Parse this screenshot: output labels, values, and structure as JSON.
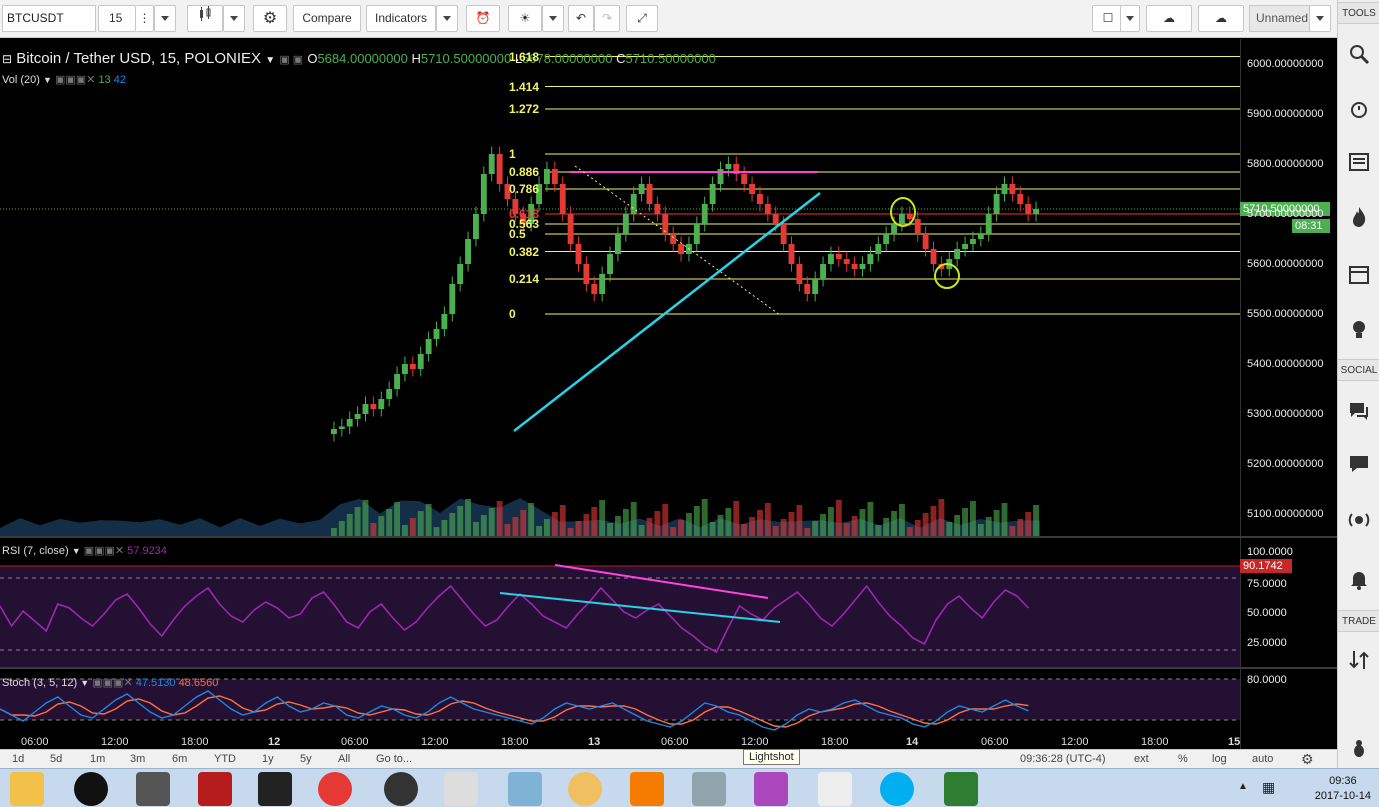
{
  "toolbar": {
    "symbol": "BTCUSDT",
    "interval": "15",
    "compare_label": "Compare",
    "indicators_label": "Indicators",
    "layout_name": "Unnamed"
  },
  "legend": {
    "title": "Bitcoin / Tether USD, 15, POLONIEX",
    "open_label": "O",
    "open": "5684.00000000",
    "high_label": "H",
    "high": "5710.50000000",
    "low_label": "L",
    "low": "5678.00000000",
    "close_label": "C",
    "close": "5710.50000000",
    "vol_label": "Vol (20)",
    "vol_a": "13",
    "vol_b": "42",
    "rsi_label": "RSI (7, close)",
    "rsi_value": "57.9234",
    "stoch_label": "Stoch (3, 5, 12)",
    "stoch_k": "47.5130",
    "stoch_d": "48.6560"
  },
  "price_axis": [
    "6000.00000000",
    "5900.00000000",
    "5800.00000000",
    "5700.00000000",
    "5600.00000000",
    "5500.00000000",
    "5400.00000000",
    "5300.00000000",
    "5200.00000000",
    "5100.00000000"
  ],
  "current_price": "5710.50000000",
  "countdown": "08:31",
  "rsi_axis": [
    "100.0000",
    "75.0000",
    "50.0000",
    "25.0000"
  ],
  "rsi_marker": "90.1742",
  "stoch_axis": [
    "80.0000"
  ],
  "time_axis": [
    "06:00",
    "12:00",
    "18:00",
    "12",
    "06:00",
    "12:00",
    "18:00",
    "13",
    "06:00",
    "12:00",
    "18:00",
    "14",
    "06:00",
    "12:00",
    "18:00",
    "15"
  ],
  "fib_levels": [
    {
      "label": "1.618",
      "price": 6015
    },
    {
      "label": "1.414",
      "price": 5955
    },
    {
      "label": "1.272",
      "price": 5910
    },
    {
      "label": "1",
      "price": 5820
    },
    {
      "label": "0.886",
      "price": 5784
    },
    {
      "label": "0.786",
      "price": 5750
    },
    {
      "label": "0.618",
      "price": 5700
    },
    {
      "label": "0.563",
      "price": 5680
    },
    {
      "label": "0.5",
      "price": 5660
    },
    {
      "label": "0.382",
      "price": 5625
    },
    {
      "label": "0.214",
      "price": 5570
    },
    {
      "label": "0",
      "price": 5500
    }
  ],
  "ranges": [
    "1d",
    "5d",
    "1m",
    "3m",
    "6m",
    "YTD",
    "1y",
    "5y",
    "All",
    "Go to..."
  ],
  "range_right": {
    "clock": "09:36:28 (UTC-4)",
    "ext": "ext",
    "pct": "%",
    "log": "log",
    "auto": "auto"
  },
  "rightbar": {
    "tools": "TOOLS",
    "social": "SOCIAL",
    "trade": "TRADE"
  },
  "tooltip": "Lightshot",
  "tray": {
    "time": "09:36",
    "date": "2017-10-14"
  },
  "colors": {
    "up": "#4caf50",
    "down": "#e53935",
    "rsi": "#9c27b0",
    "stoch_k": "#1e88e5",
    "stoch_d": "#ff7043",
    "trend": "#2ad1e8",
    "magenta": "#ff44dd",
    "fib": "#f3f36a",
    "fib_red": "#e53935"
  },
  "chart_data": {
    "type": "line",
    "price_series": [
      5270,
      5275,
      5290,
      5300,
      5320,
      5310,
      5330,
      5350,
      5380,
      5400,
      5390,
      5420,
      5450,
      5470,
      5500,
      5560,
      5600,
      5650,
      5700,
      5780,
      5820,
      5760,
      5730,
      5700,
      5680,
      5720,
      5760,
      5790,
      5760,
      5700,
      5640,
      5600,
      5560,
      5540,
      5580,
      5620,
      5660,
      5700,
      5740,
      5760,
      5720,
      5700,
      5660,
      5640,
      5620,
      5640,
      5680,
      5720,
      5760,
      5790,
      5800,
      5780,
      5760,
      5740,
      5720,
      5700,
      5680,
      5640,
      5600,
      5560,
      5540,
      5570,
      5600,
      5620,
      5610,
      5600,
      5590,
      5600,
      5620,
      5640,
      5660,
      5680,
      5700,
      5690,
      5660,
      5630,
      5600,
      5590,
      5610,
      5630,
      5640,
      5650,
      5660,
      5700,
      5740,
      5760,
      5740,
      5720,
      5700,
      5710
    ],
    "rsi_series": [
      60,
      40,
      55,
      45,
      35,
      62,
      58,
      48,
      40,
      52,
      66,
      72,
      58,
      42,
      30,
      46,
      60,
      70,
      78,
      62,
      50,
      44,
      56,
      64,
      58,
      48,
      52,
      68,
      74,
      60,
      44,
      38,
      54,
      62,
      48,
      36,
      44,
      58,
      70,
      80,
      66,
      52,
      40,
      46,
      60,
      72,
      62,
      50,
      44,
      38,
      52,
      64,
      78,
      66,
      54,
      48,
      56,
      62,
      50,
      38,
      30,
      20,
      14,
      38,
      60,
      52,
      46,
      58,
      66,
      74,
      62,
      48,
      40,
      52,
      66,
      80,
      64,
      50,
      40,
      28,
      22,
      46,
      62,
      70,
      58,
      48,
      64,
      76,
      70,
      58
    ],
    "stoch_k_series": [
      50,
      40,
      30,
      45,
      60,
      70,
      55,
      40,
      35,
      50,
      65,
      75,
      60,
      45,
      35,
      40,
      55,
      70,
      80,
      65,
      50,
      40,
      45,
      60,
      70,
      55,
      45,
      50,
      60,
      55,
      40,
      35,
      45,
      55,
      50,
      40,
      35,
      45,
      60,
      70,
      60,
      50,
      45,
      40,
      35,
      30,
      25,
      35,
      50,
      60,
      55,
      50,
      55,
      60,
      50,
      40,
      30,
      25,
      20,
      30,
      45,
      60,
      55,
      45,
      40,
      30,
      20,
      15,
      25,
      40,
      50,
      45,
      50,
      60,
      65,
      55,
      45,
      40,
      35,
      25,
      20,
      30,
      45,
      55,
      50,
      45,
      55,
      65,
      55,
      47
    ]
  }
}
